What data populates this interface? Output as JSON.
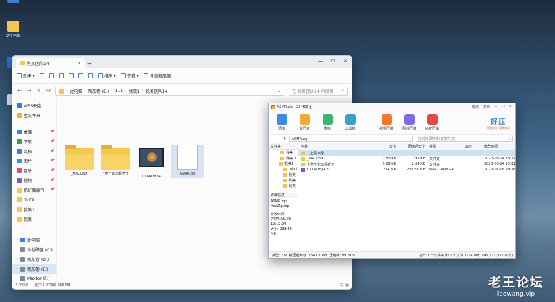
{
  "desktop": {
    "icons": [
      {
        "label": "",
        "color": "#3e7bd6"
      },
      {
        "label": "这个电脑",
        "color": "#f2c84b"
      },
      {
        "label": "WPS",
        "color": "#2c6ee6"
      }
    ]
  },
  "explorer": {
    "tab_title": "购买团队14",
    "command_bar": [
      "新建",
      "排序",
      "查看",
      "全部解压缩"
    ],
    "address": [
      "此电脑",
      "新加卷 (E:)",
      "111",
      "我美1",
      "我美团队14"
    ],
    "search_placeholder": "在 我美团队14 中搜索",
    "nav": [
      {
        "label": "WPS云盘",
        "color": "#2f7de1",
        "pin": false
      },
      {
        "label": "主文件夹",
        "color": "#f0b23a",
        "pin": false
      },
      {
        "label": "桌面",
        "color": "#3a7ee0",
        "pin": true
      },
      {
        "label": "下载",
        "color": "#3a9a4e",
        "pin": true
      },
      {
        "label": "文档",
        "color": "#4c7bc0",
        "pin": true
      },
      {
        "label": "图片",
        "color": "#3d8fe6",
        "pin": true
      },
      {
        "label": "音乐",
        "color": "#e2487d",
        "pin": true
      },
      {
        "label": "视频",
        "color": "#7b5ad6",
        "pin": true
      },
      {
        "label": "抓好图编气",
        "color": "#f2c84b",
        "pin": true
      },
      {
        "label": "mimi",
        "color": "#f2c84b",
        "pin": false
      },
      {
        "label": "我美1",
        "color": "#f2c84b",
        "pin": false
      },
      {
        "label": "我美",
        "color": "#f2c84b",
        "pin": false
      }
    ],
    "drives": [
      {
        "label": "此电脑",
        "color": "#3a7ee0"
      },
      {
        "label": "本地磁盘 (C:)",
        "color": "#7a8a9c"
      },
      {
        "label": "新加卷 (D:)",
        "color": "#7a8a9c"
      },
      {
        "label": "新加卷 (E:)",
        "color": "#7a8a9c"
      },
      {
        "label": "Maxtor (F:)",
        "color": "#7a8a9c"
      }
    ],
    "files": [
      {
        "name": "_MACOSX",
        "type": "folder"
      },
      {
        "name": "上老王论坛看老王",
        "type": "folder"
      },
      {
        "name": "1 (14).mp4",
        "type": "video"
      },
      {
        "name": "ASMR.zip",
        "type": "zip"
      }
    ],
    "status": {
      "count": "4 个项目",
      "selected": "选中 1 个项目  233 MB"
    }
  },
  "haozip": {
    "title": "ASMR.zip - 2345好压",
    "title_tools": [
      "皮肤",
      "菜单"
    ],
    "toolbar": [
      {
        "label": "添加",
        "color": "#3c8de0"
      },
      {
        "label": "解压到",
        "color": "#f2a93b"
      },
      {
        "label": "删除",
        "color": "#3cb371"
      },
      {
        "label": "工具箱",
        "color": "#39a0c8"
      },
      {
        "label": "视频压缩",
        "color": "#f07a2a"
      },
      {
        "label": "图片压缩",
        "color": "#7d6cdc"
      },
      {
        "label": "PDF压缩",
        "color": "#e8483f"
      }
    ],
    "brand": {
      "big": "好压",
      "small": "高效专业  简单易用"
    },
    "path": "ASMR.zip",
    "search_placeholder": "当前目录搜索(支持中文)",
    "tree_header": "文件夹",
    "tree": [
      "我美",
      "我美 1",
      "我美1",
      "mimi",
      "我美",
      "我美",
      "我美"
    ],
    "info": {
      "header": "详细信息",
      "lines": [
        "ASMR.zip",
        "HaoZip.zip",
        "",
        "修改时间:",
        "2023-08-24",
        "19:12:24",
        "大小: 233.58 MB"
      ]
    },
    "columns": {
      "name": "名称",
      "size": "大小",
      "csize": "压缩后大小",
      "type": "类型",
      "enc": "加密",
      "date": "修改时间"
    },
    "rows": [
      {
        "name": "..(上层目录)",
        "size": "",
        "csize": "",
        "type": "",
        "enc": "",
        "date": "",
        "icon": "#f1c54b",
        "sel": true
      },
      {
        "name": "_MACOSX",
        "size": "2.83 KB",
        "csize": "1.95 KB",
        "type": "文件夹",
        "enc": "",
        "date": "2023-08-24 19:11",
        "icon": "#f1c54b",
        "sel": false
      },
      {
        "name": "上老王论坛看老王",
        "size": "9.09 KB",
        "csize": "2.64 KB",
        "type": "文件夹",
        "enc": "",
        "date": "2023-08-24 19:11",
        "icon": "#f1c54b",
        "sel": false
      },
      {
        "name": "1 (14).mp4 *",
        "size": "234 MB",
        "csize": "233.58 MB",
        "type": "MP4 - MPEG-4 ...",
        "enc": "",
        "date": "2023-07-06 20:26",
        "icon": "#6c5ae0",
        "sel": false
      }
    ],
    "status_left": "类型: ZIP, 解压后大小: 234.01 MB, 压缩率: 99.81%",
    "status_right": "总计 1 个文件夹 和 1 个文件 (234 MB, 245,373,652 字节)"
  },
  "watermark": {
    "cn": "老王论坛",
    "url": "laowang.vip"
  }
}
